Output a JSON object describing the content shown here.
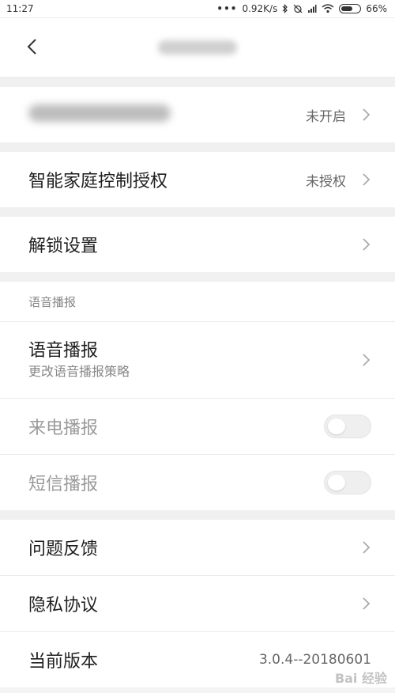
{
  "status_bar": {
    "time": "11:27",
    "network_speed": "0.92K/s",
    "battery": "66%",
    "battery_fraction": 0.66
  },
  "header": {
    "title": ""
  },
  "group1": {
    "item_value": "未开启"
  },
  "group2": {
    "label": "智能家庭控制授权",
    "value": "未授权"
  },
  "group3": {
    "label": "解锁设置"
  },
  "voice_section": {
    "header": "语音播报",
    "items": [
      {
        "label": "语音播报",
        "subtitle": "更改语音播报策略"
      },
      {
        "label": "来电播报",
        "enabled": false
      },
      {
        "label": "短信播报",
        "enabled": false
      }
    ]
  },
  "about_section": {
    "feedback": "问题反馈",
    "privacy": "隐私协议",
    "version_label": "当前版本",
    "version_value": "3.0.4--20180601"
  },
  "watermark": "Bai 经验"
}
